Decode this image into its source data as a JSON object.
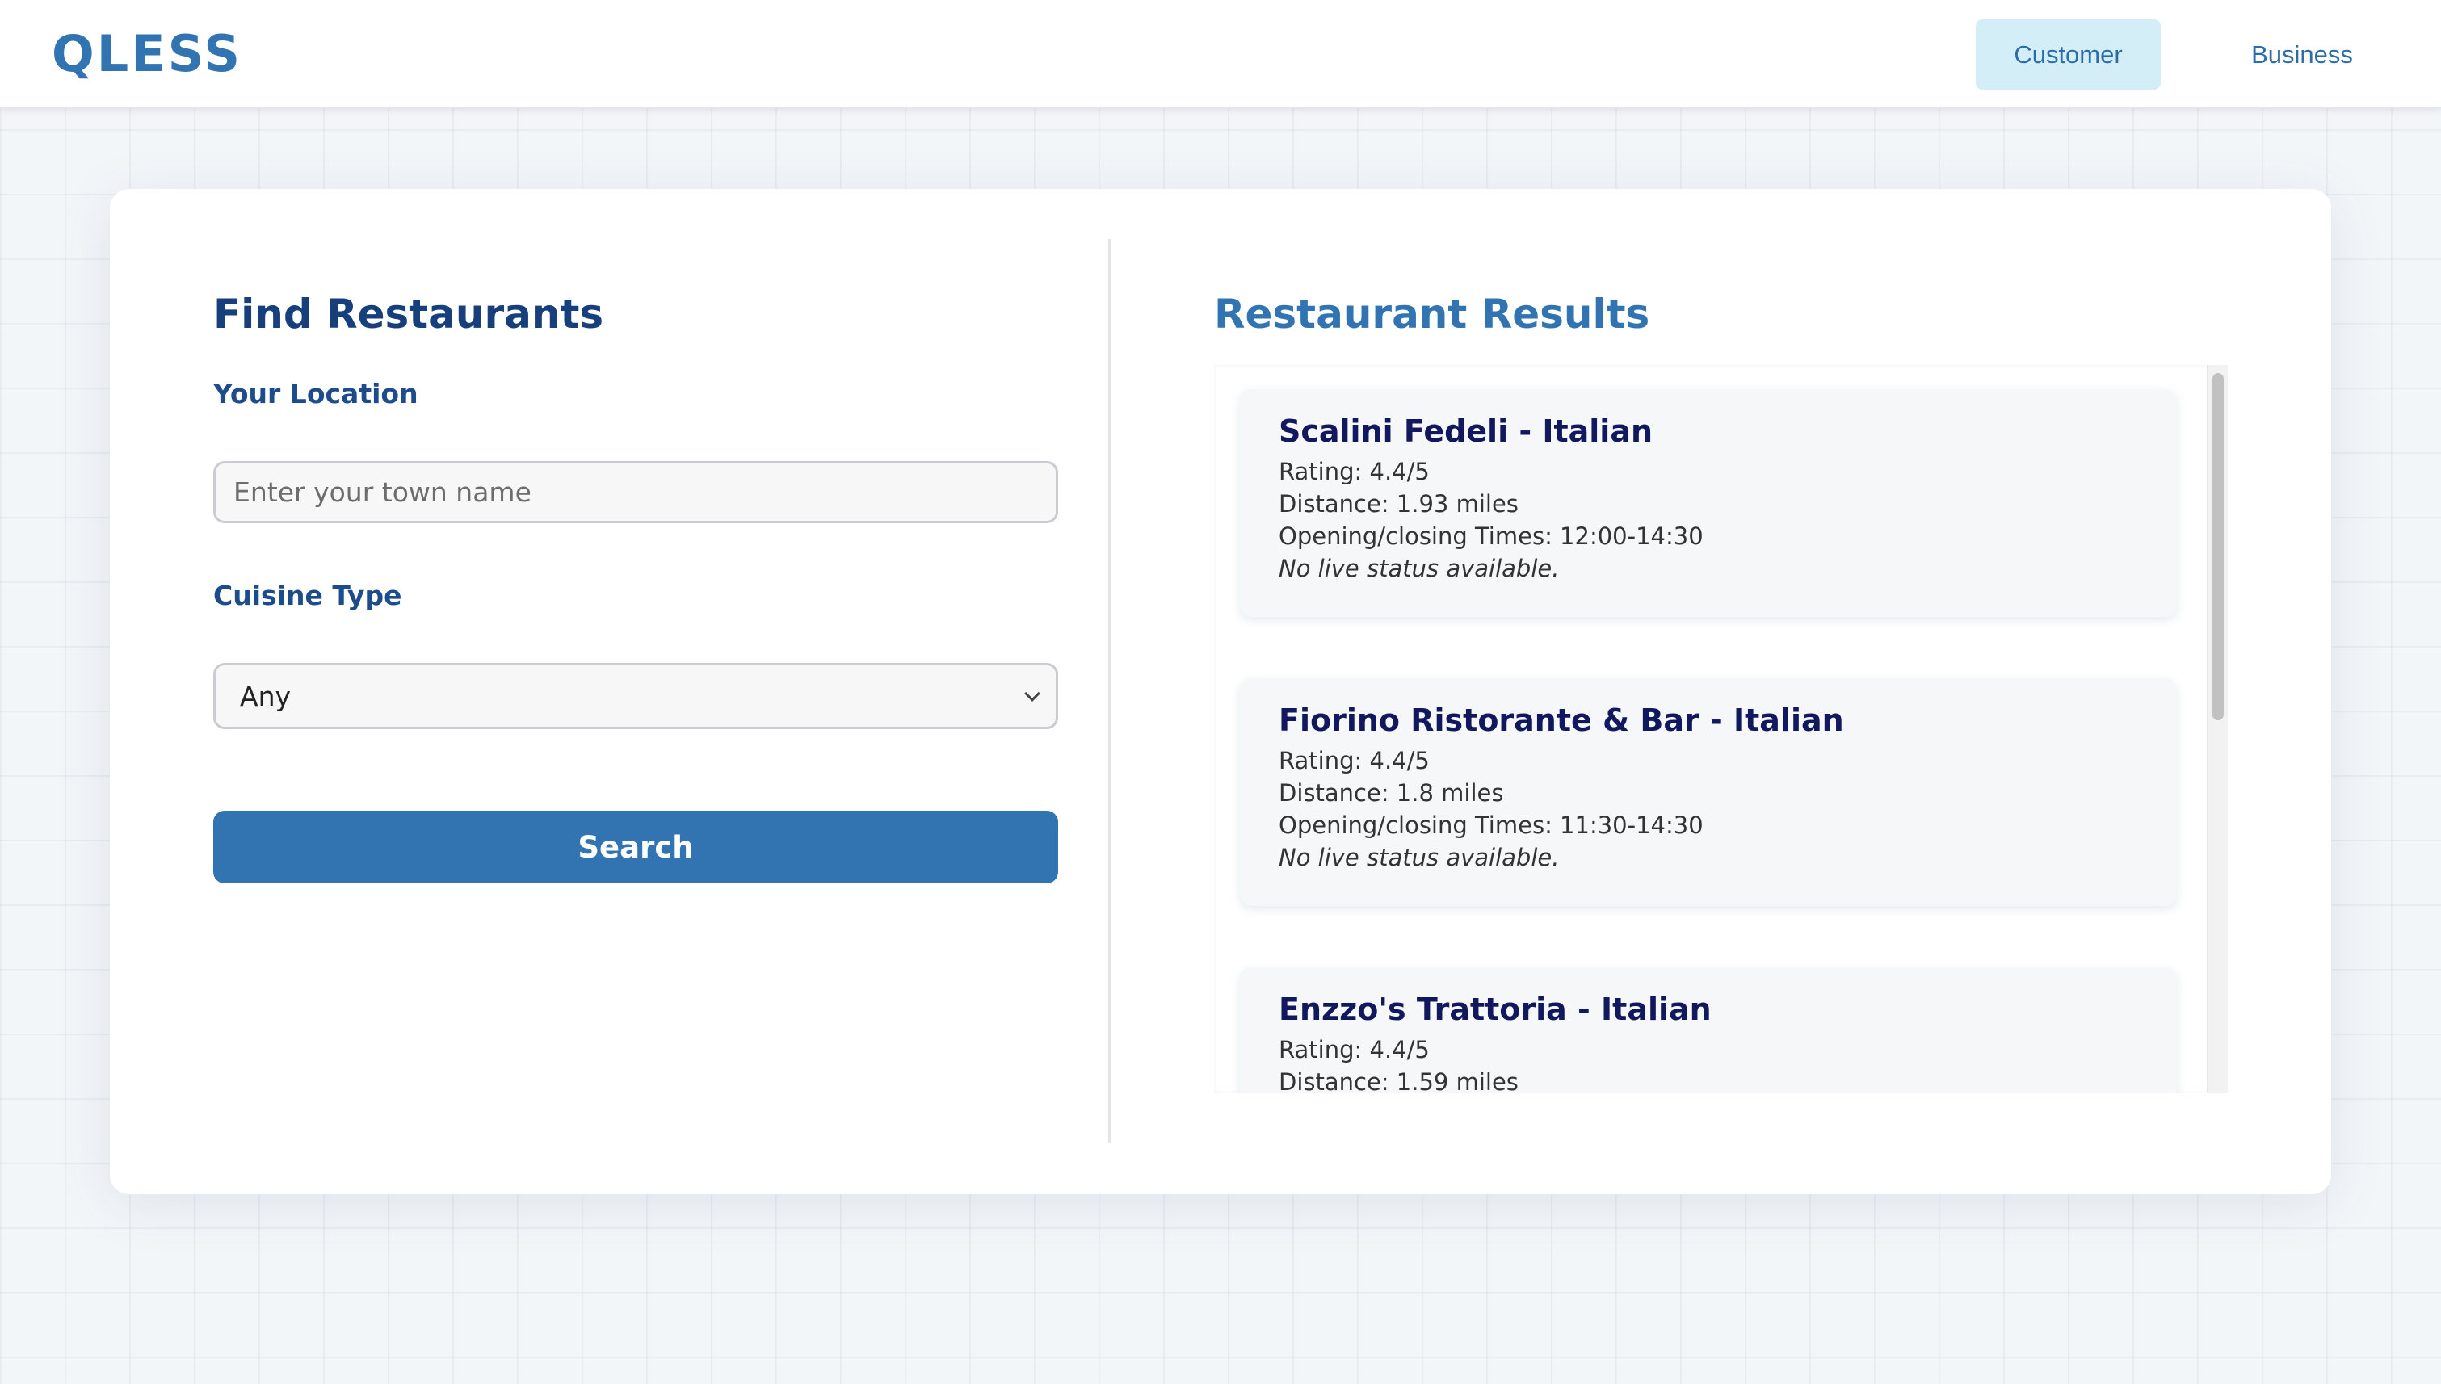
{
  "app": {
    "logo": "QLESS"
  },
  "nav": {
    "customer_label": "Customer",
    "business_label": "Business"
  },
  "search_panel": {
    "title": "Find Restaurants",
    "location_label": "Your Location",
    "location_placeholder": "Enter your town name",
    "location_value": "",
    "cuisine_label": "Cuisine Type",
    "cuisine_selected": "Any",
    "search_label": "Search"
  },
  "results_panel": {
    "title": "Restaurant Results",
    "results": [
      {
        "name": "Scalini Fedeli - Italian",
        "rating": "Rating: 4.4/5",
        "distance": "Distance: 1.93 miles",
        "hours": "Opening/closing Times: 12:00-14:30",
        "status": "No live status available."
      },
      {
        "name": "Fiorino Ristorante & Bar - Italian",
        "rating": "Rating: 4.4/5",
        "distance": "Distance: 1.8 miles",
        "hours": "Opening/closing Times: 11:30-14:30",
        "status": "No live status available."
      },
      {
        "name": "Enzzo's Trattoria - Italian",
        "rating": "Rating: 4.4/5",
        "distance": "Distance: 1.59 miles",
        "hours": "",
        "status": ""
      }
    ]
  },
  "colors": {
    "brand": "#3274b2",
    "heading_dark": "#173f7c",
    "nav_active_bg": "#d4eef7",
    "result_name": "#11185e"
  }
}
